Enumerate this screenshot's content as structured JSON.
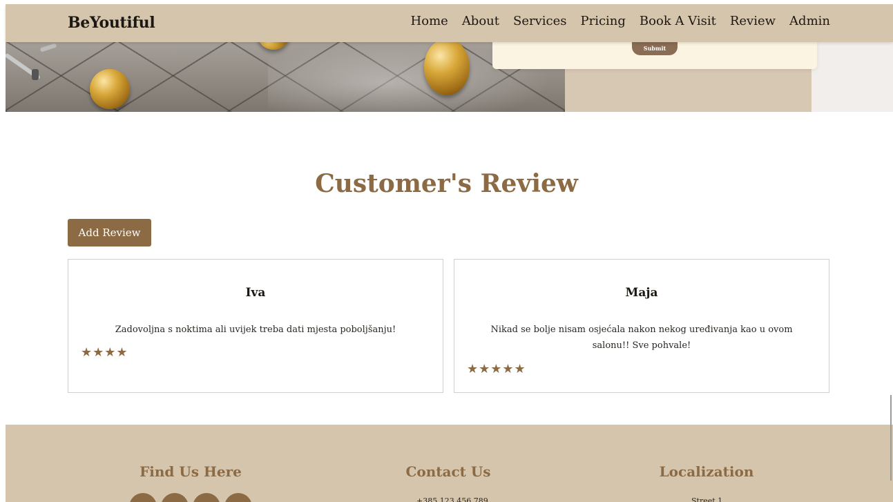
{
  "navbar": {
    "brand": "BeYoutiful",
    "links": [
      "Home",
      "About",
      "Services",
      "Pricing",
      "Book A Visit",
      "Review",
      "Admin"
    ]
  },
  "hero": {
    "submit_label": "Submit"
  },
  "reviews": {
    "title": "Customer's Review",
    "add_button": "Add Review",
    "items": [
      {
        "name": "Iva",
        "text": "Zadovoljna s noktima ali uvijek treba dati mjesta poboljšanju!",
        "rating": 4,
        "stars": "★★★★"
      },
      {
        "name": "Maja",
        "text": "Nikad se bolje nisam osjećala nakon nekog uređivanja kao u ovom salonu!! Sve pohvale!",
        "rating": 5,
        "stars": "★★★★★"
      }
    ]
  },
  "footer": {
    "find_us_title": "Find Us Here",
    "contact_title": "Contact Us",
    "localization_title": "Localization",
    "phone": "+385 123 456 789",
    "street": "Street 1"
  },
  "colors": {
    "accent": "#8b6a44",
    "navbar_bg": "#d6c5ad"
  }
}
